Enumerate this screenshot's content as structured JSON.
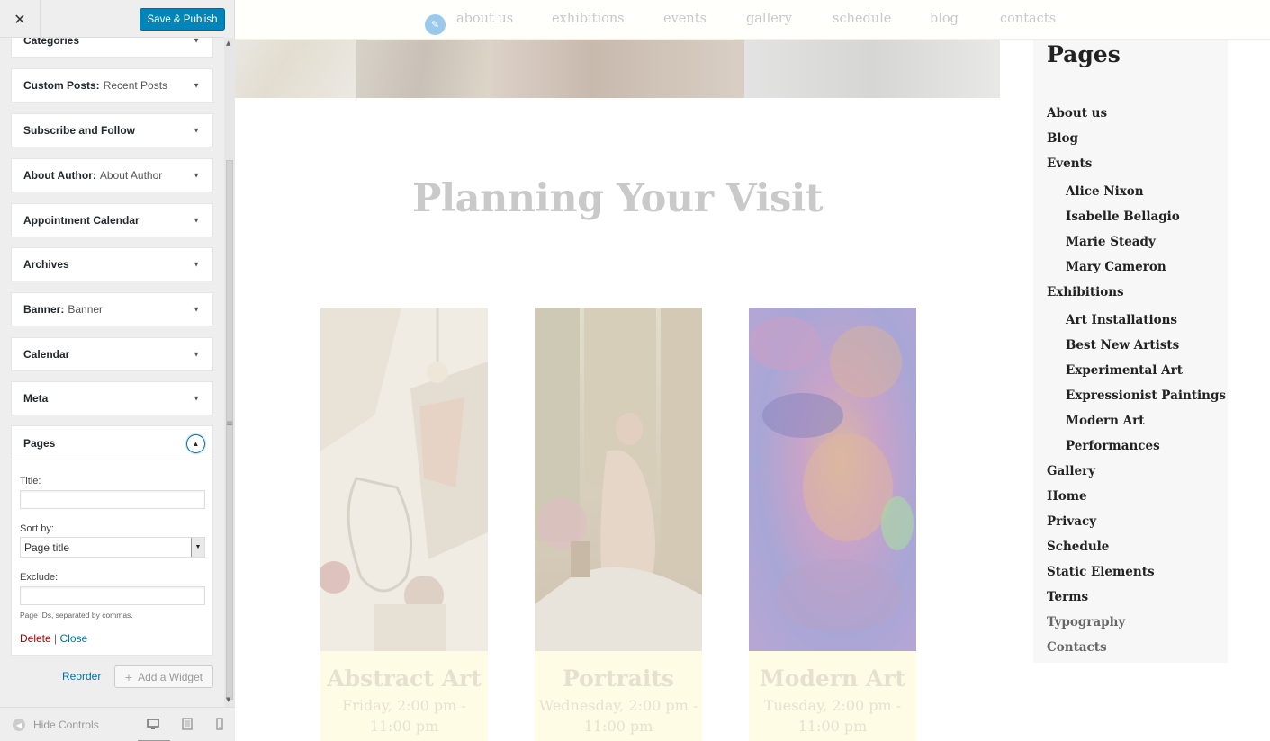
{
  "customizer": {
    "close_label": "✕",
    "save_label": "Save & Publish",
    "widgets": [
      {
        "title": "Categories",
        "instance": ""
      },
      {
        "title": "Custom Posts:",
        "instance": "Recent Posts"
      },
      {
        "title": "Subscribe and Follow",
        "instance": ""
      },
      {
        "title": "About Author:",
        "instance": "About Author"
      },
      {
        "title": "Appointment Calendar",
        "instance": ""
      },
      {
        "title": "Archives",
        "instance": ""
      },
      {
        "title": "Banner:",
        "instance": "Banner"
      },
      {
        "title": "Calendar",
        "instance": ""
      },
      {
        "title": "Meta",
        "instance": ""
      }
    ],
    "pages_widget": {
      "title": "Pages",
      "title_label": "Title:",
      "title_value": "",
      "sort_label": "Sort by:",
      "sort_value": "Page title",
      "exclude_label": "Exclude:",
      "exclude_value": "",
      "help": "Page IDs, separated by commas.",
      "delete_label": "Delete",
      "separator": "|",
      "close_label": "Close"
    },
    "reorder_label": "Reorder",
    "add_widget_label": "Add a Widget",
    "hide_controls_label": "Hide Controls"
  },
  "preview": {
    "nav": [
      "about us",
      "exhibitions",
      "events",
      "gallery",
      "schedule",
      "blog",
      "contacts"
    ],
    "heading": "Planning Your Visit",
    "cards": [
      {
        "title": "Abstract Art",
        "time": "Friday, 2:00 pm - 11:00 pm"
      },
      {
        "title": "Portraits",
        "time": "Wednesday, 2:00 pm - 11:00 pm"
      },
      {
        "title": "Modern Art",
        "time": "Tuesday, 2:00 pm - 11:00 pm"
      }
    ],
    "pages_widget": {
      "title": "Pages",
      "items": [
        {
          "label": "About us",
          "level": 0
        },
        {
          "label": "Blog",
          "level": 0
        },
        {
          "label": "Events",
          "level": 0
        },
        {
          "label": "Alice Nixon",
          "level": 1
        },
        {
          "label": "Isabelle Bellagio",
          "level": 1
        },
        {
          "label": "Marie Steady",
          "level": 1
        },
        {
          "label": "Mary Cameron",
          "level": 1
        },
        {
          "label": "Exhibitions",
          "level": 0
        },
        {
          "label": "Art Installations",
          "level": 1
        },
        {
          "label": "Best New Artists",
          "level": 1
        },
        {
          "label": "Experimental Art",
          "level": 1
        },
        {
          "label": "Expressionist Paintings",
          "level": 1
        },
        {
          "label": "Modern Art",
          "level": 1
        },
        {
          "label": "Performances",
          "level": 1
        },
        {
          "label": "Gallery",
          "level": 0
        },
        {
          "label": "Home",
          "level": 0
        },
        {
          "label": "Privacy",
          "level": 0
        },
        {
          "label": "Schedule",
          "level": 0
        },
        {
          "label": "Static Elements",
          "level": 0
        },
        {
          "label": "Terms",
          "level": 0
        },
        {
          "label": "Typography",
          "level": 0
        },
        {
          "label": "Contacts",
          "level": 0
        }
      ]
    }
  },
  "colors": {
    "primary_button": "#0085ba",
    "link": "#0073aa",
    "delete": "#aa0000",
    "card_info_bg": "#fffce6"
  }
}
